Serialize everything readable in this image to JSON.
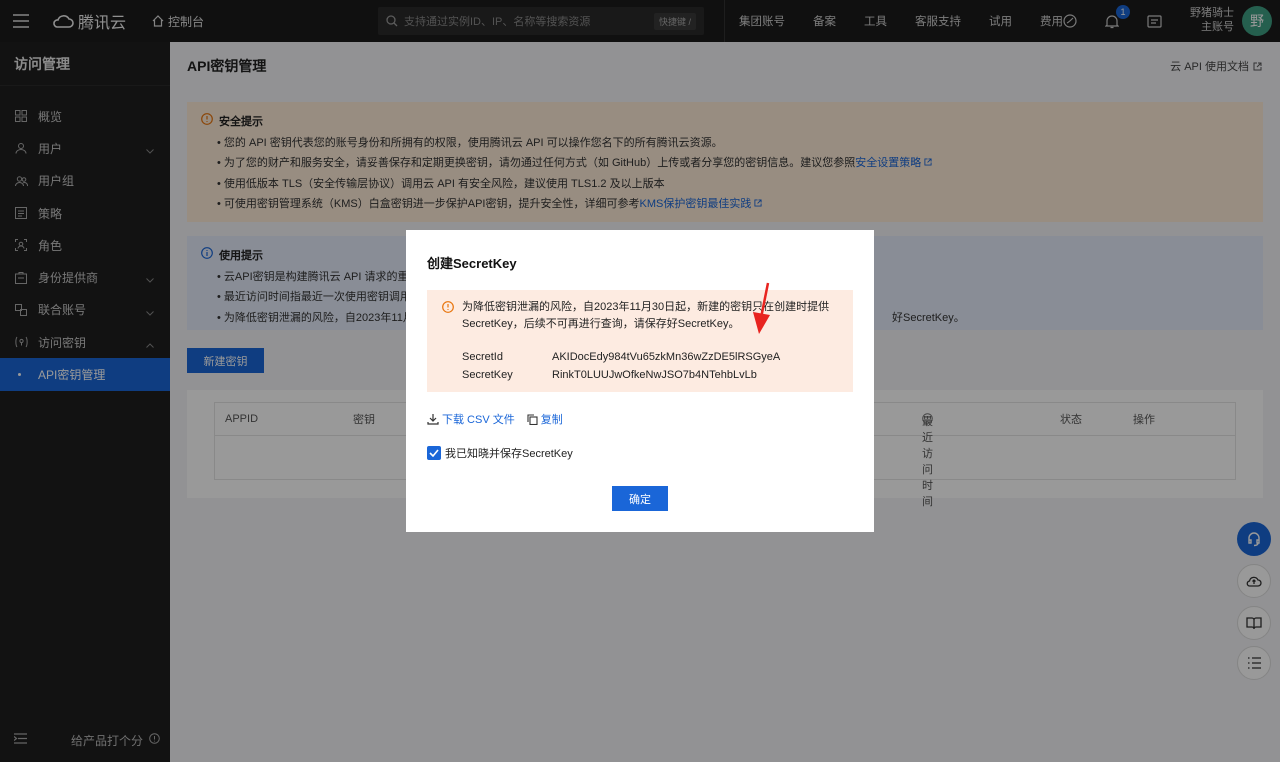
{
  "topbar": {
    "logo_text": "腾讯云",
    "console_label": "控制台",
    "search_placeholder": "支持通过实例ID、IP、名称等搜索资源",
    "search_shortcut": "快捷键 /",
    "nav": [
      "集团账号",
      "备案",
      "工具",
      "客服支持",
      "试用",
      "费用"
    ],
    "notification_count": "1",
    "user_name": "野猪骑士",
    "user_role": "主账号",
    "avatar_char": "野"
  },
  "sidebar": {
    "title": "访问管理",
    "items": [
      {
        "label": "概览",
        "icon": "overview-icon"
      },
      {
        "label": "用户",
        "icon": "user-icon"
      },
      {
        "label": "用户组",
        "icon": "user-group-icon"
      },
      {
        "label": "策略",
        "icon": "policy-icon"
      },
      {
        "label": "角色",
        "icon": "role-icon"
      },
      {
        "label": "身份提供商",
        "icon": "idp-icon"
      },
      {
        "label": "联合账号",
        "icon": "federated-icon"
      },
      {
        "label": "访问密钥",
        "icon": "access-key-icon"
      }
    ],
    "sub_item": "API密钥管理",
    "footer_text": "给产品打个分"
  },
  "main": {
    "title": "API密钥管理",
    "doc_link": "云 API 使用文档",
    "security": {
      "title": "安全提示",
      "items": [
        "您的 API 密钥代表您的账号身份和所拥有的权限，使用腾讯云 API 可以操作您名下的所有腾讯云资源。",
        "为了您的财产和服务安全，请妥善保存和定期更换密钥，请勿通过任何方式（如 GitHub）上传或者分享您的密钥信息。建议您参照",
        "使用低版本 TLS（安全传输层协议）调用云 API 有安全风险，建议使用 TLS1.2 及以上版本",
        "可使用密钥管理系统（KMS）白盒密钥进一步保护API密钥，提升安全性，详细可参考"
      ],
      "link1": "安全设置策略",
      "link2": "KMS保护密钥最佳实践"
    },
    "usage": {
      "title": "使用提示",
      "items": [
        "云API密钥是构建腾讯云 API 请求的重要",
        "最近访问时间指最近一次使用密钥调用",
        "为降低密钥泄漏的风险，自2023年11月"
      ],
      "item3_tail": "好SecretKey。"
    },
    "new_button": "新建密钥",
    "table_headers": {
      "appid": "APPID",
      "key": "密钥",
      "last_access": "最近访问时间",
      "status": "状态",
      "actions": "操作"
    }
  },
  "dialog": {
    "title": "创建SecretKey",
    "warning_line1": "为降低密钥泄漏的风险，自2023年11月30日起，新建的密钥只在创建时提供",
    "warning_line2": "SecretKey，后续不可再进行查询，请保存好SecretKey。",
    "secret_id_label": "SecretId",
    "secret_id_value": "AKIDocEdy984tVu65zkMn36wZzDE5lRSGyeA",
    "secret_key_label": "SecretKey",
    "secret_key_value": "RinkT0LUUJwOfkeNwJSO7b4NTehbLvLb",
    "download_label": "下载 CSV 文件",
    "copy_label": "复制",
    "checkbox_label": "我已知晓并保存SecretKey",
    "checkbox_checked": true,
    "ok_label": "确定"
  },
  "colors": {
    "primary": "#1a66d8",
    "annotation_arrow": "#e8231f"
  }
}
